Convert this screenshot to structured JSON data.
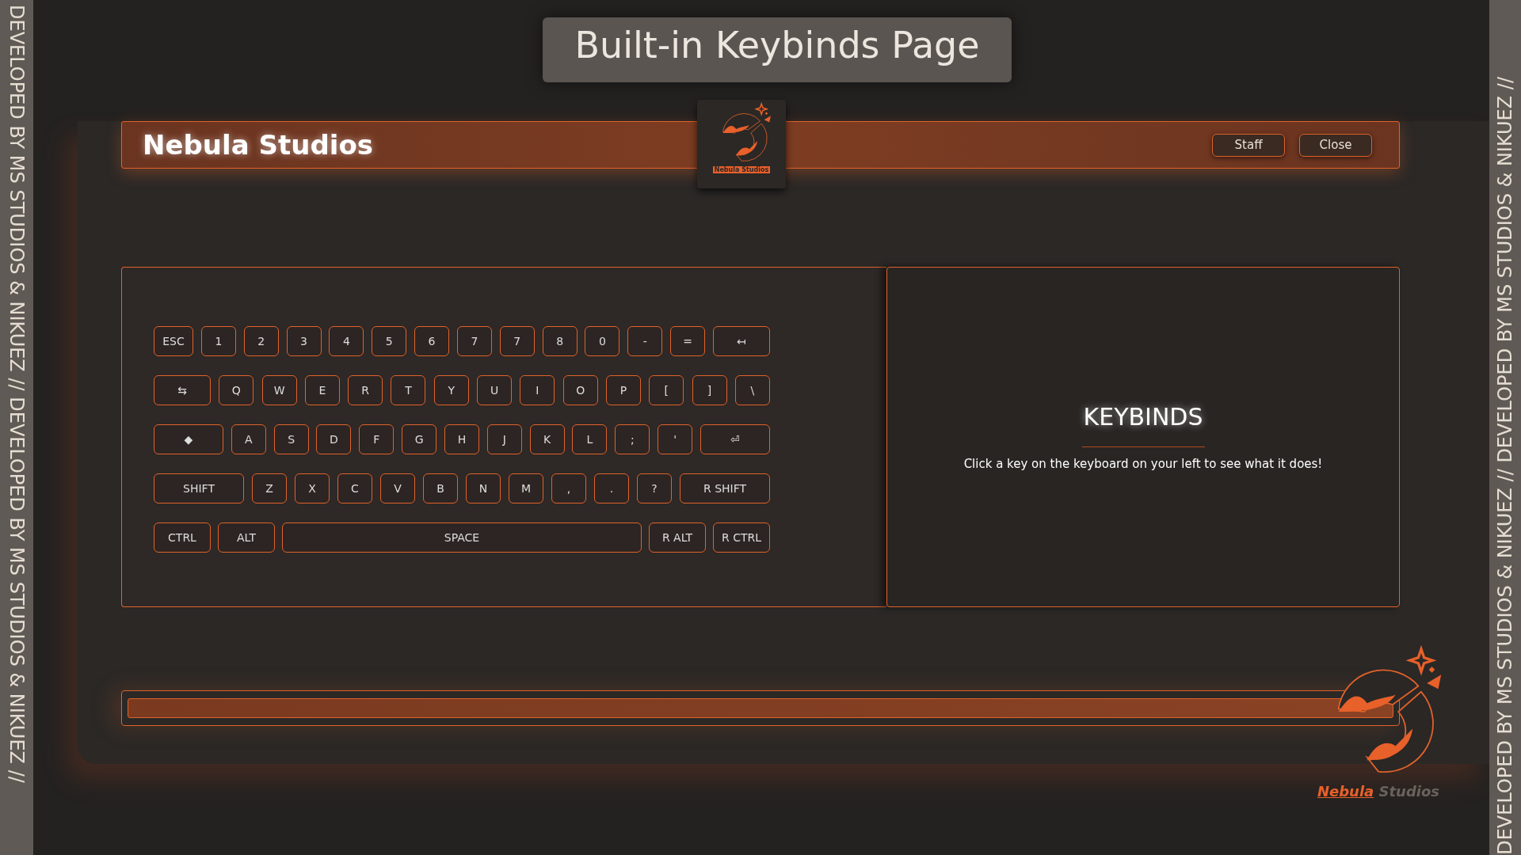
{
  "side_text_left": "DEVELOPED BY MS STUDIOS & NIKUEZ // DEVELOPED BY MS STUDIOS & NIKUEZ //",
  "side_text_right": "DEVELOPED BY MS STUDIOS & NIKUEZ // DEVELOPED BY MS STUDIOS & NIKUEZ //",
  "page_title": "Built-in Keybinds Page",
  "header": {
    "brand": "Nebula Studios",
    "logo_caption": "Nebula Studios",
    "buttons": [
      "Staff",
      "Close"
    ]
  },
  "keyboard": {
    "rows": [
      {
        "keys": [
          {
            "label": "ESC",
            "kind": "key"
          },
          {
            "label": "1",
            "kind": "key"
          },
          {
            "label": "2",
            "kind": "key"
          },
          {
            "label": "3",
            "kind": "key"
          },
          {
            "label": "4",
            "kind": "key"
          },
          {
            "label": "5",
            "kind": "key"
          },
          {
            "label": "6",
            "kind": "key"
          },
          {
            "label": "7",
            "kind": "key"
          },
          {
            "label": "7",
            "kind": "key"
          },
          {
            "label": "8",
            "kind": "key"
          },
          {
            "label": "0",
            "kind": "key"
          },
          {
            "label": "-",
            "kind": "key"
          },
          {
            "label": "=",
            "kind": "key"
          },
          {
            "label": "↤",
            "kind": "mod"
          }
        ]
      },
      {
        "keys": [
          {
            "label": "⇆",
            "kind": "mod"
          },
          {
            "label": "Q",
            "kind": "key"
          },
          {
            "label": "W",
            "kind": "key"
          },
          {
            "label": "E",
            "kind": "key"
          },
          {
            "label": "R",
            "kind": "key"
          },
          {
            "label": "T",
            "kind": "key"
          },
          {
            "label": "Y",
            "kind": "key"
          },
          {
            "label": "U",
            "kind": "key"
          },
          {
            "label": "I",
            "kind": "key"
          },
          {
            "label": "O",
            "kind": "key"
          },
          {
            "label": "P",
            "kind": "key"
          },
          {
            "label": "[",
            "kind": "key"
          },
          {
            "label": "]",
            "kind": "key"
          },
          {
            "label": "\\",
            "kind": "key"
          }
        ]
      },
      {
        "keys": [
          {
            "label": "◆",
            "kind": "wide"
          },
          {
            "label": "A",
            "kind": "key"
          },
          {
            "label": "S",
            "kind": "key"
          },
          {
            "label": "D",
            "kind": "key"
          },
          {
            "label": "F",
            "kind": "key"
          },
          {
            "label": "G",
            "kind": "key"
          },
          {
            "label": "H",
            "kind": "key"
          },
          {
            "label": "J",
            "kind": "key"
          },
          {
            "label": "K",
            "kind": "key"
          },
          {
            "label": "L",
            "kind": "key"
          },
          {
            "label": ";",
            "kind": "key"
          },
          {
            "label": "'",
            "kind": "key"
          },
          {
            "label": "⏎",
            "kind": "wide"
          }
        ]
      },
      {
        "keys": [
          {
            "label": "SHIFT",
            "kind": "xwide"
          },
          {
            "label": "Z",
            "kind": "key"
          },
          {
            "label": "X",
            "kind": "key"
          },
          {
            "label": "C",
            "kind": "key"
          },
          {
            "label": "V",
            "kind": "key"
          },
          {
            "label": "B",
            "kind": "key"
          },
          {
            "label": "N",
            "kind": "key"
          },
          {
            "label": "M",
            "kind": "key"
          },
          {
            "label": ",",
            "kind": "key"
          },
          {
            "label": ".",
            "kind": "key"
          },
          {
            "label": "?",
            "kind": "key"
          },
          {
            "label": "R SHIFT",
            "kind": "xwide"
          }
        ]
      },
      {
        "keys": [
          {
            "label": "CTRL",
            "kind": "mod"
          },
          {
            "label": "ALT",
            "kind": "mod"
          },
          {
            "label": "SPACE",
            "kind": "space"
          },
          {
            "label": "R ALT",
            "kind": "mod"
          },
          {
            "label": "R CTRL",
            "kind": "mod"
          }
        ]
      }
    ]
  },
  "info_panel": {
    "heading": "KEYBINDS",
    "text": "Click a key on the keyboard on your left to see what it does!"
  },
  "corner_logo": {
    "word_1": "Nebula",
    "word_2": "Studios"
  }
}
